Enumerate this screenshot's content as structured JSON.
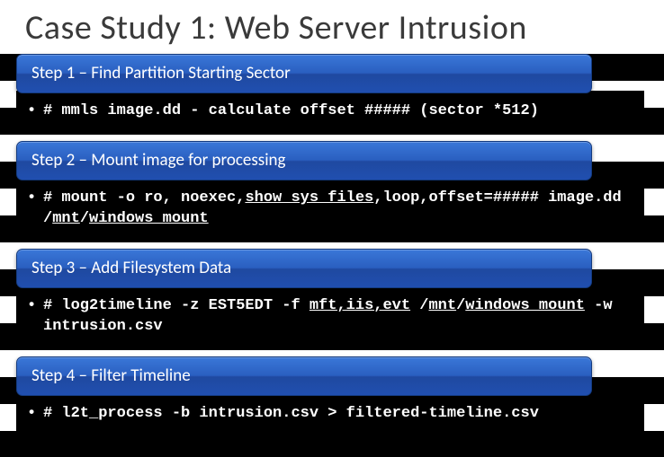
{
  "title": "Case Study 1: Web Server Intrusion",
  "steps": [
    {
      "header": "Step 1 – Find Partition Starting Sector",
      "cmd_html": "# mmls image.dd - calculate offset ##### (sector *512)"
    },
    {
      "header": "Step 2 – Mount image for processing",
      "cmd_html": "# mount -o ro, noexec,<span class='u'>show_sys_files</span>,loop,offset=##### image.dd /<span class='u'>mnt</span>/<span class='u'>windows_mount</span>"
    },
    {
      "header": "Step 3 – Add Filesystem Data",
      "cmd_html": "# log2timeline -z EST5EDT -f <span class='u'>mft,iis,evt</span> /<span class='u'>mnt</span>/<span class='u'>windows_mount</span> -w intrusion.csv"
    },
    {
      "header": "Step 4 – Filter Timeline",
      "cmd_html": "# l2t_process -b intrusion.csv > filtered-timeline.csv"
    }
  ]
}
